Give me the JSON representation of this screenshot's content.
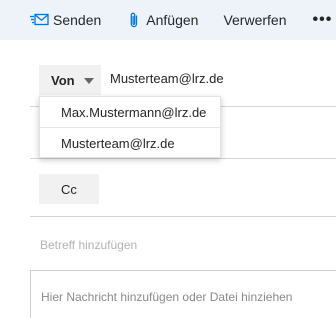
{
  "toolbar": {
    "send_label": "Senden",
    "send_icon": "send-envelope-icon",
    "attach_label": "Anfügen",
    "attach_icon": "paperclip-icon",
    "discard_label": "Verwerfen",
    "more_label": "•••"
  },
  "from": {
    "label": "Von",
    "address": "Musterteam@lrz.de",
    "options": [
      "Max.Mustermann@lrz.de",
      "Musterteam@lrz.de"
    ]
  },
  "cc": {
    "label": "Cc"
  },
  "subject": {
    "placeholder": "Betreff hinzufügen",
    "value": ""
  },
  "message": {
    "placeholder": "Hier Nachricht hinzufügen oder Datei hinziehen"
  },
  "colors": {
    "toolbar_bg": "#edf3f9",
    "accent": "#0078d4",
    "button_bg": "#f1f1f1"
  }
}
